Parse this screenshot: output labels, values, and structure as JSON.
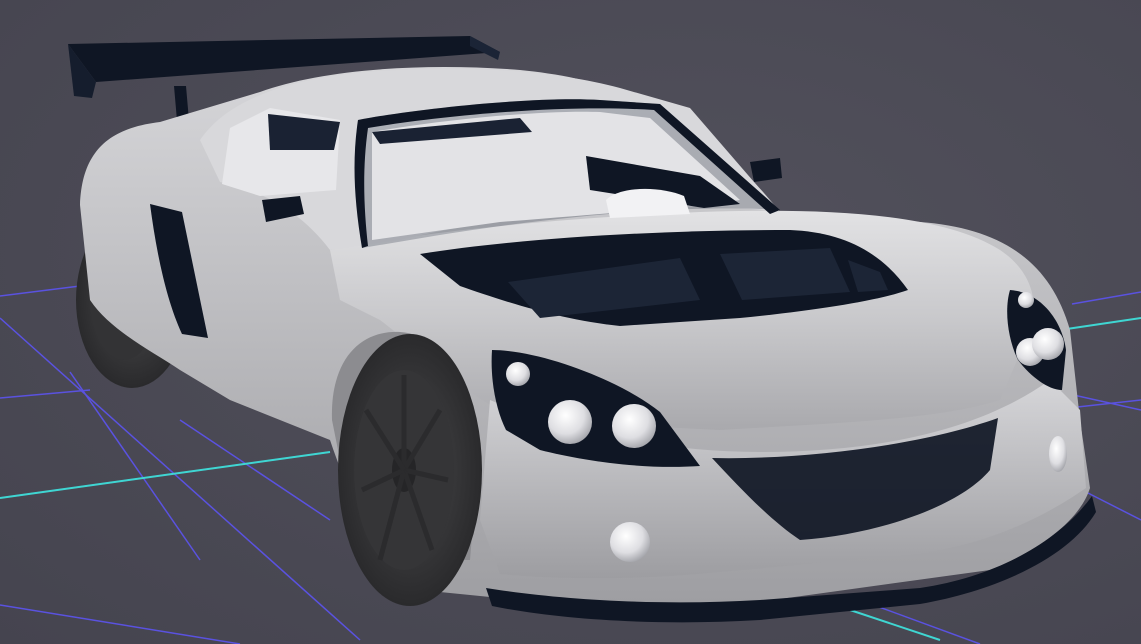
{
  "scene": {
    "background_color": "#4b4a55",
    "grid_line_color": "#5a52e0",
    "grid_axis_color": "#3fd6d2",
    "model": {
      "body_color": "#c9c9cc",
      "trim_color": "#0f1624",
      "wheel_color": "#3a3a3c",
      "light_color": "#ececee"
    }
  }
}
